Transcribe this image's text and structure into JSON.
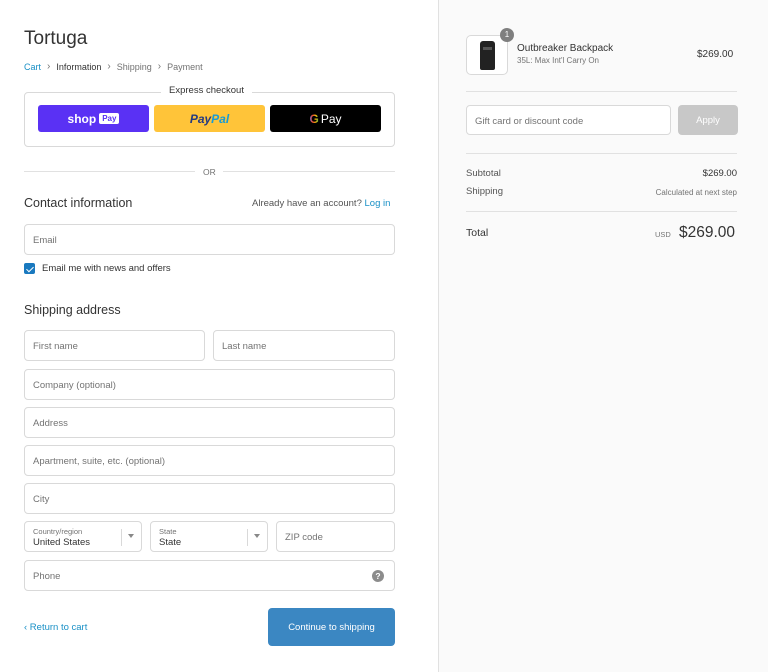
{
  "store": {
    "title": "Tortuga"
  },
  "breadcrumb": {
    "cart": "Cart",
    "information": "Information",
    "shipping": "Shipping",
    "payment": "Payment"
  },
  "express": {
    "title": "Express checkout",
    "shop_pay": "shop",
    "shop_pay_badge": "Pay",
    "paypal_1": "Pay",
    "paypal_2": "Pal",
    "gpay_g": "G",
    "gpay": "Pay",
    "or": "OR"
  },
  "contact": {
    "heading": "Contact information",
    "account_text": "Already have an account?",
    "login": "Log in",
    "email_placeholder": "Email",
    "newsletter_label": "Email me with news and offers",
    "newsletter_checked": true
  },
  "shipping": {
    "heading": "Shipping address",
    "first_name": "First name",
    "last_name": "Last name",
    "company": "Company (optional)",
    "address": "Address",
    "apartment": "Apartment, suite, etc. (optional)",
    "city": "City",
    "country_label": "Country/region",
    "country_value": "United States",
    "state_label": "State",
    "state_value": "State",
    "zip": "ZIP code",
    "phone": "Phone",
    "help_icon": "?"
  },
  "actions": {
    "return": "‹ Return to cart",
    "continue": "Continue to shipping"
  },
  "order": {
    "quantity": "1",
    "product_name": "Outbreaker Backpack",
    "product_variant": "35L: Max Int'l Carry On",
    "product_price": "$269.00",
    "discount_placeholder": "Gift card or discount code",
    "apply": "Apply",
    "subtotal_label": "Subtotal",
    "subtotal_value": "$269.00",
    "shipping_label": "Shipping",
    "shipping_value": "Calculated at next step",
    "total_label": "Total",
    "currency": "USD",
    "total_value": "$269.00"
  },
  "colors": {
    "accent": "#1990c6",
    "primary_button": "#3b87c2",
    "shop_pay": "#5a31f4",
    "paypal": "#ffc439"
  }
}
